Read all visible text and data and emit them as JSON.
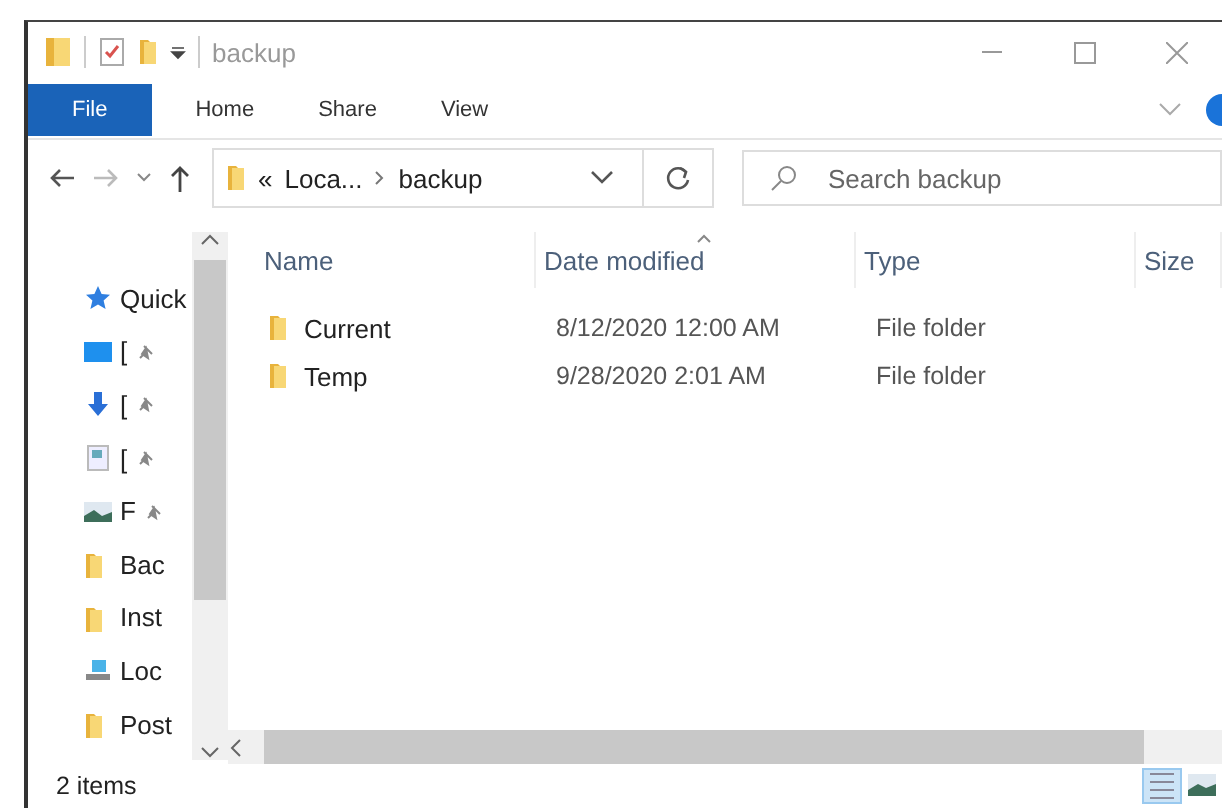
{
  "window": {
    "title": "backup"
  },
  "ribbon_tabs": [
    {
      "label": "File",
      "kind": "file"
    },
    {
      "label": "Home",
      "kind": "tab"
    },
    {
      "label": "Share",
      "kind": "tab"
    },
    {
      "label": "View",
      "kind": "tab"
    }
  ],
  "address": {
    "overflow": "«",
    "segments": [
      "Loca...",
      "backup"
    ]
  },
  "search": {
    "placeholder": "Search backup"
  },
  "sidebar": {
    "items": [
      {
        "label": "Quick",
        "kind": "star",
        "pinned": false
      },
      {
        "label": "[",
        "kind": "desktop",
        "pinned": true
      },
      {
        "label": "[",
        "kind": "download",
        "pinned": true
      },
      {
        "label": "[",
        "kind": "document",
        "pinned": true
      },
      {
        "label": "F",
        "kind": "pictures",
        "pinned": true
      },
      {
        "label": "Bac",
        "kind": "folder",
        "pinned": false
      },
      {
        "label": "Inst",
        "kind": "folder",
        "pinned": false
      },
      {
        "label": "Loc",
        "kind": "drive",
        "pinned": false
      },
      {
        "label": "Post",
        "kind": "folder",
        "pinned": false
      }
    ]
  },
  "table": {
    "columns": [
      {
        "label": "Name",
        "sorted": false
      },
      {
        "label": "Date modified",
        "sorted": true
      },
      {
        "label": "Type",
        "sorted": false
      },
      {
        "label": "Size",
        "sorted": false
      }
    ],
    "rows": [
      {
        "name": "Current",
        "date": "8/12/2020 12:00 AM",
        "type": "File folder"
      },
      {
        "name": "Temp",
        "date": "9/28/2020 2:01 AM",
        "type": "File folder"
      }
    ]
  },
  "status_bar": {
    "text": "2 items",
    "views": [
      {
        "kind": "details",
        "selected": true
      },
      {
        "kind": "large",
        "selected": false
      }
    ]
  }
}
